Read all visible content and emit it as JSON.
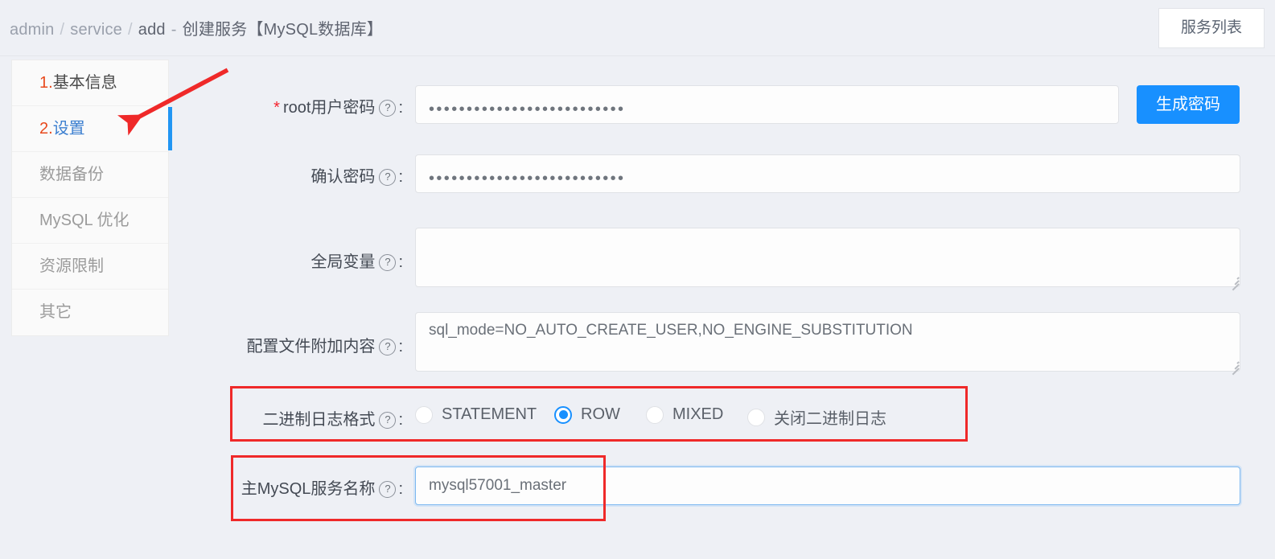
{
  "header": {
    "breadcrumb": {
      "root": "admin",
      "section": "service",
      "action": "add",
      "separator": "/",
      "dash": "-",
      "title": "创建服务【MySQL数据库】"
    },
    "service_list_button": "服务列表"
  },
  "sidebar": {
    "items": [
      {
        "num": "1.",
        "label": "基本信息",
        "state": "visited"
      },
      {
        "num": "2.",
        "label": "设置",
        "state": "active"
      },
      {
        "num": "",
        "label": "数据备份",
        "state": "disabled"
      },
      {
        "num": "",
        "label": "MySQL 优化",
        "state": "disabled"
      },
      {
        "num": "",
        "label": "资源限制",
        "state": "disabled"
      },
      {
        "num": "",
        "label": "其它",
        "state": "disabled"
      }
    ]
  },
  "form": {
    "help_icon": "?",
    "required_mark": "*",
    "colon": ":",
    "fields": {
      "root_password": {
        "label": "root用户密码",
        "value": "••••••••••••••••••••••••••",
        "required": true,
        "generate_button": "生成密码"
      },
      "confirm_password": {
        "label": "确认密码",
        "value": "••••••••••••••••••••••••••",
        "required": false
      },
      "global_variables": {
        "label": "全局变量",
        "value": "",
        "placeholder": ""
      },
      "config_append": {
        "label": "配置文件附加内容",
        "value": "sql_mode=NO_AUTO_CREATE_USER,NO_ENGINE_SUBSTITUTION"
      },
      "binlog_format": {
        "label": "二进制日志格式",
        "selected": "ROW",
        "options": [
          {
            "value": "STATEMENT",
            "label": "STATEMENT"
          },
          {
            "value": "ROW",
            "label": "ROW"
          },
          {
            "value": "MIXED",
            "label": "MIXED"
          },
          {
            "value": "OFF",
            "label": "关闭二进制日志"
          }
        ]
      },
      "master_service_name": {
        "label": "主MySQL服务名称",
        "value": "mysql57001_master"
      }
    }
  },
  "annotations": {
    "arrow_color": "#ef2929",
    "box_color": "#ef2929",
    "active_bar_color": "#2196f3"
  },
  "colors": {
    "page_background": "#eef0f5",
    "primary": "#1890ff",
    "accent_orange": "#e8491d",
    "active_link": "#3c7fd0"
  }
}
